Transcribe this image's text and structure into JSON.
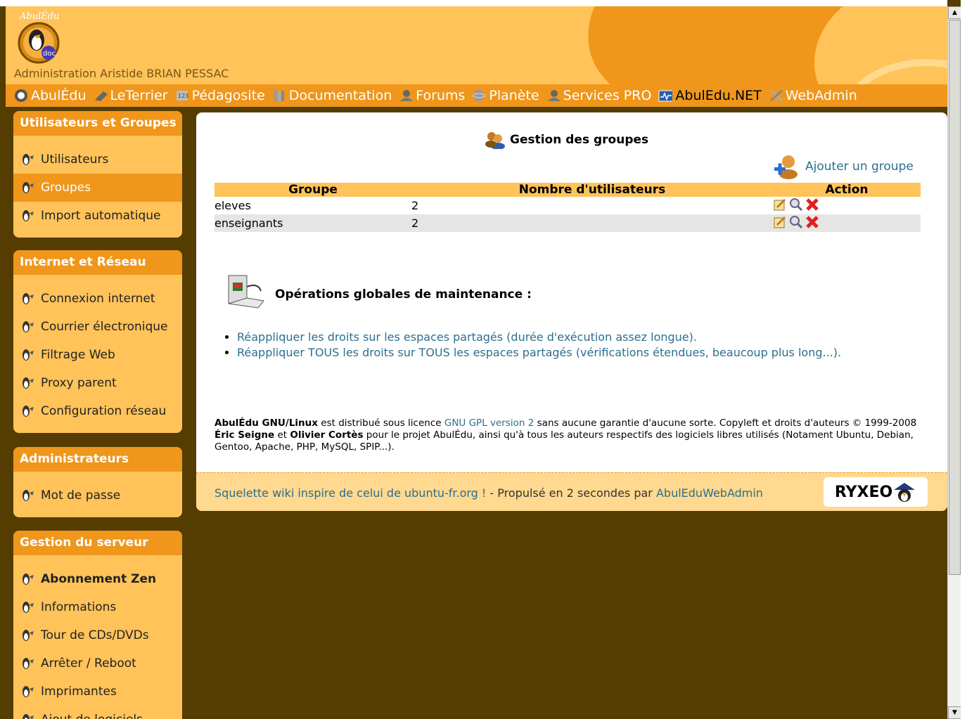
{
  "header": {
    "admin_title": "Administration Aristide BRIAN PESSAC"
  },
  "nav": {
    "items": [
      {
        "label": "AbulÉdu",
        "icon": "abuledu-icon"
      },
      {
        "label": "LeTerrier",
        "icon": "terrier-icon"
      },
      {
        "label": "Pédagosite",
        "icon": "pedagosite-icon"
      },
      {
        "label": "Documentation",
        "icon": "documentation-icon"
      },
      {
        "label": "Forums",
        "icon": "forums-icon"
      },
      {
        "label": "Planète",
        "icon": "planet-icon"
      },
      {
        "label": "Services PRO",
        "icon": "services-icon"
      },
      {
        "label": "AbulEdu.NET",
        "icon": "network-icon"
      },
      {
        "label": "WebAdmin",
        "icon": "tools-icon"
      }
    ]
  },
  "sidebar": {
    "sections": [
      {
        "title": "Utilisateurs et Groupes",
        "items": [
          "Utilisateurs",
          "Groupes",
          "Import automatique"
        ]
      },
      {
        "title": "Internet et Réseau",
        "items": [
          "Connexion internet",
          "Courrier électronique",
          "Filtrage Web",
          "Proxy parent",
          "Configuration réseau"
        ]
      },
      {
        "title": "Administrateurs",
        "items": [
          "Mot de passe"
        ]
      },
      {
        "title": "Gestion du serveur",
        "items": [
          "Abonnement Zen",
          "Informations",
          "Tour de CDs/DVDs",
          "Arrêter / Reboot",
          "Imprimantes",
          "Ajout de logiciels"
        ]
      }
    ]
  },
  "main": {
    "title": "Gestion des groupes",
    "add_group": "Ajouter un groupe",
    "table": {
      "headers": [
        "Groupe",
        "Nombre d'utilisateurs",
        "Action"
      ],
      "rows": [
        {
          "group": "eleves",
          "count": "2"
        },
        {
          "group": "enseignants",
          "count": "2"
        }
      ]
    },
    "maintenance": {
      "title": "Opérations globales de maintenance :",
      "links": [
        "Réappliquer les droits sur les espaces partagés (durée d'exécution assez longue).",
        "Réappliquer TOUS les droits sur TOUS les espaces partagés (vérifications étendues, beaucoup plus long...)."
      ]
    },
    "license": {
      "product": "AbulÉdu GNU/Linux",
      "t1": " est distribué sous licence ",
      "gpl": "GNU GPL version 2",
      "t2": " sans aucune garantie d'aucune sorte. Copyleft et droits d'auteurs © 1999-2008 ",
      "author1": "Éric Seigne",
      "t3": " et ",
      "author2": "Olivier Cortès",
      "t4": " pour le projet AbulÉdu, ainsi qu'à tous les auteurs respectifs des logiciels libres utilisés (Notament Ubuntu, Debian, Gentoo, Apache, PHP, MySQL, SPIP...)."
    },
    "footer": {
      "skeleton_link": "Squelette wiki inspire de celui de ubuntu-fr.org !",
      "middle": " - Propulsé en 2 secondes par ",
      "webadmin_link": "AbulEduWebAdmin",
      "brand": "RYXEO"
    }
  },
  "colors": {
    "header_bg": "#ffc35a",
    "accent": "#ef961b",
    "page_bg": "#553c00",
    "link": "#2b6f8f"
  }
}
